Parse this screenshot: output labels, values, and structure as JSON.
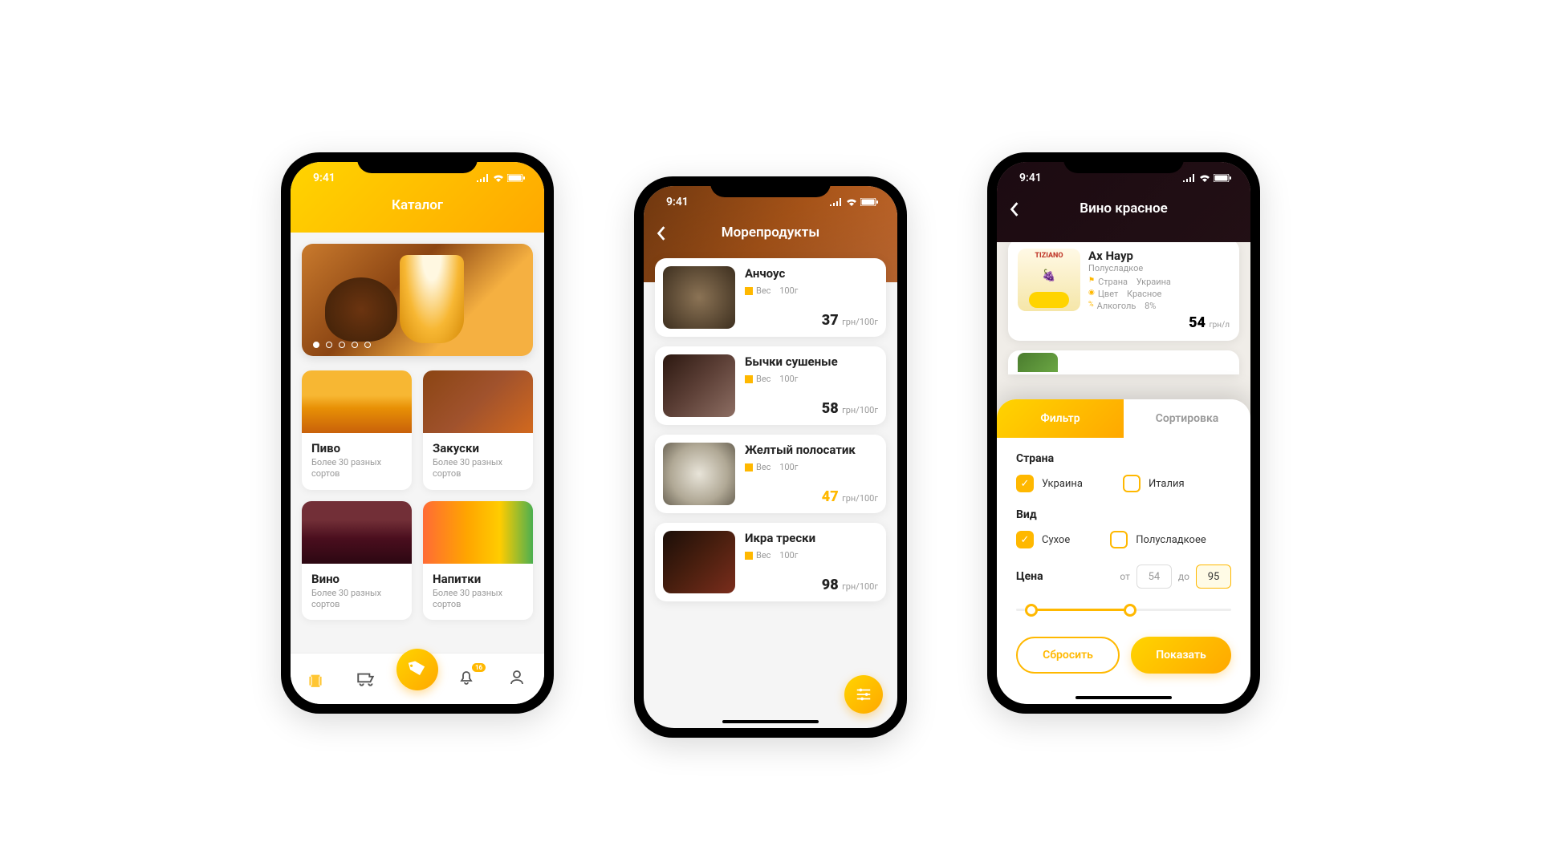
{
  "status_time": "9:41",
  "nav_badge": "16",
  "phone1": {
    "title": "Каталог",
    "categories": [
      {
        "name": "Пиво",
        "sub": "Более 30 разных сортов"
      },
      {
        "name": "Закуски",
        "sub": "Более 30 разных сортов"
      },
      {
        "name": "Вино",
        "sub": "Более 30 разных сортов"
      },
      {
        "name": "Напитки",
        "sub": "Более 30 разных сортов"
      }
    ]
  },
  "phone2": {
    "title": "Морепродукты",
    "weight_label": "Вес",
    "weight_value": "100г",
    "currency": "грн",
    "per": "/100г",
    "products": [
      {
        "name": "Анчоус",
        "price": "37"
      },
      {
        "name": "Бычки сушеные",
        "price": "58"
      },
      {
        "name": "Желтый полосатик",
        "price": "47"
      },
      {
        "name": "Икра трески",
        "price": "98"
      }
    ]
  },
  "phone3": {
    "title": "Вино красное",
    "wine": {
      "brand": "TIZIANO",
      "name": "Ах Наур",
      "sub": "Полусладкое",
      "country_label": "Страна",
      "country": "Украина",
      "color_label": "Цвет",
      "color": "Красное",
      "alc_label": "Алкоголь",
      "alc": "8%",
      "price": "54",
      "currency": "грн",
      "per": "/л"
    },
    "sheet": {
      "tab_filter": "Фильтр",
      "tab_sort": "Сортировка",
      "country_label": "Страна",
      "country_options": [
        {
          "label": "Украина",
          "checked": true
        },
        {
          "label": "Италия",
          "checked": false
        }
      ],
      "type_label": "Вид",
      "type_options": [
        {
          "label": "Сухое",
          "checked": true
        },
        {
          "label": "Полусладкоее",
          "checked": false
        }
      ],
      "price_label": "Цена",
      "from_label": "от",
      "to_label": "до",
      "from_value": "54",
      "to_value": "95",
      "reset": "Сбросить",
      "apply": "Показать"
    }
  }
}
